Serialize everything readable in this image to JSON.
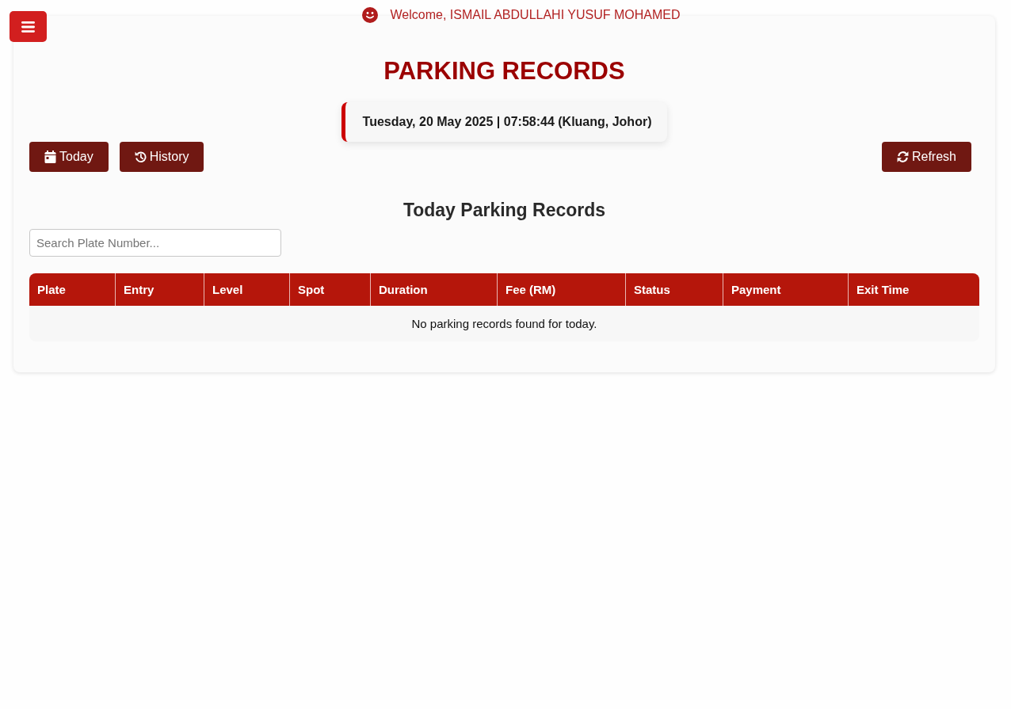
{
  "welcome": {
    "text": "Welcome, ISMAIL ABDULLAHI YUSUF MOHAMED"
  },
  "title": "PARKING RECORDS",
  "datetime": "Tuesday, 20 May 2025 | 07:58:44 (Kluang, Johor)",
  "today_button": {
    "label": "Today"
  },
  "history_button": {
    "label": "History"
  },
  "refresh_button": {
    "label": "Refresh"
  },
  "section_title": "Today Parking Records",
  "search": {
    "placeholder": "Search Plate Number..."
  },
  "table": {
    "columns": [
      "Plate",
      "Entry",
      "Level",
      "Spot",
      "Duration",
      "Fee (RM)",
      "Status",
      "Payment",
      "Exit Time"
    ],
    "empty_message": "No parking records found for today."
  }
}
